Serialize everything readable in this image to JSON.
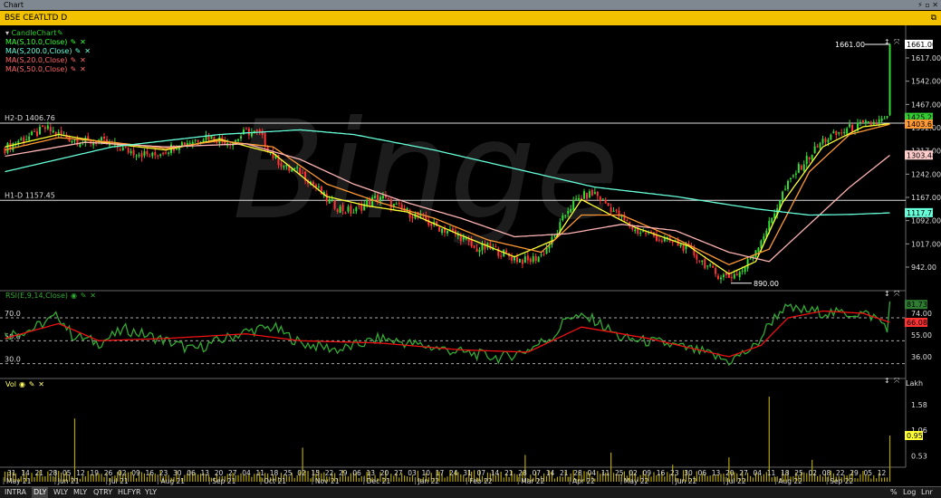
{
  "window": {
    "title": "Chart",
    "controls": [
      "⚡",
      "▫",
      "✕"
    ]
  },
  "symbol_bar": {
    "symbol": "BSE CEATLTD D",
    "icon": "restore-icon"
  },
  "main_panel": {
    "chart_label": "CandleChart",
    "indicators": [
      {
        "label": "MA(S,10.0,Close)",
        "color": "#33ff33"
      },
      {
        "label": "MA(S,200.0,Close)",
        "color": "#66ffd9"
      },
      {
        "label": "MA(S,20.0,Close)",
        "color": "#ff6666"
      },
      {
        "label": "MA(S,50.0,Close)",
        "color": "#ff6666"
      }
    ],
    "hlines": [
      {
        "label": "H2-D 1406.76",
        "value": 1406.76
      },
      {
        "label": "H1-D 1157.45",
        "value": 1157.45
      }
    ],
    "price_axis": [
      "1617.00",
      "1542.00",
      "1467.00",
      "1392.00",
      "1317.00",
      "1242.00",
      "1167.00",
      "1092.00",
      "1017.00",
      "942.00"
    ],
    "price_tags": [
      {
        "text": "1661.00",
        "value": 1661.0,
        "bg": "#ffffff",
        "fg": "#000000"
      },
      {
        "text": "1425.25",
        "value": 1425.25,
        "bg": "#33cc33",
        "fg": "#000000"
      },
      {
        "text": "1403.65",
        "value": 1403.65,
        "bg": "#ff9933",
        "fg": "#000000"
      },
      {
        "text": "1303.48",
        "value": 1303.48,
        "bg": "#ffcccc",
        "fg": "#000000"
      },
      {
        "text": "1117.73",
        "value": 1117.73,
        "bg": "#66ffd9",
        "fg": "#000000"
      }
    ],
    "annotations": [
      {
        "text": "1661.00",
        "value": 1661.0
      },
      {
        "text": "890.00",
        "value": 890.0
      }
    ],
    "watermark": "Binge"
  },
  "rsi_panel": {
    "label": "RSI(E,9,14,Close)",
    "levels": [
      "70.0",
      "50.0",
      "30.0"
    ],
    "axis": [
      "74.00",
      "55.00",
      "36.00"
    ],
    "tags": [
      {
        "text": "81.73",
        "bg": "#2e7d32",
        "fg": "#000000"
      },
      {
        "text": "66.08",
        "bg": "#ff3333",
        "fg": "#000000"
      }
    ]
  },
  "vol_panel": {
    "label": "Vol",
    "unit": "Lakh",
    "axis": [
      "1.58",
      "1.06",
      "0.53"
    ],
    "tag": {
      "text": "0.95",
      "bg": "#ffff33",
      "fg": "#000000"
    }
  },
  "date_axis": {
    "days": [
      "31",
      "14",
      "21",
      "28",
      "05",
      "12",
      "19",
      "26",
      "02",
      "09",
      "16",
      "23",
      "30",
      "06",
      "13",
      "20",
      "27",
      "04",
      "11",
      "18",
      "25",
      "02",
      "15",
      "22",
      "29",
      "06",
      "13",
      "20",
      "27",
      "03",
      "10",
      "17",
      "24",
      "31",
      "07",
      "14",
      "21",
      "28",
      "07",
      "14",
      "21",
      "28",
      "04",
      "11",
      "25",
      "02",
      "09",
      "16",
      "23",
      "30",
      "06",
      "13",
      "20",
      "27",
      "04",
      "11",
      "18",
      "25",
      "02",
      "08",
      "22",
      "29",
      "05",
      "12"
    ],
    "months": [
      "May 21",
      "Jun 21",
      "Jul 21",
      "Aug 21",
      "Sep 21",
      "Oct 21",
      "Nov 21",
      "Dec 21",
      "Jan 22",
      "Feb 22",
      "Mar 22",
      "Apr 22",
      "May 22",
      "Jun 22",
      "Jul 22",
      "Aug 22",
      "Sep 22"
    ]
  },
  "bottom_bar": {
    "timeframes": [
      "INTRA",
      "DLY",
      "WLY",
      "MLY",
      "QTRY",
      "HLFYR",
      "YLY"
    ],
    "active": "DLY",
    "right": [
      "%",
      "Log",
      "Lnr"
    ]
  },
  "chart_data": {
    "type": "candlestick",
    "y_range": [
      890,
      1661
    ],
    "series": [
      {
        "name": "CandleChart",
        "anchors": [
          [
            0,
            1325
          ],
          [
            5,
            1350
          ],
          [
            10,
            1365
          ],
          [
            15,
            1390
          ],
          [
            20,
            1370
          ],
          [
            25,
            1355
          ],
          [
            30,
            1345
          ],
          [
            35,
            1350
          ],
          [
            40,
            1335
          ],
          [
            45,
            1320
          ],
          [
            50,
            1310
          ],
          [
            55,
            1300
          ],
          [
            60,
            1320
          ],
          [
            65,
            1340
          ],
          [
            70,
            1350
          ],
          [
            75,
            1365
          ],
          [
            80,
            1355
          ],
          [
            85,
            1345
          ],
          [
            90,
            1380
          ],
          [
            95,
            1370
          ],
          [
            100,
            1300
          ],
          [
            105,
            1260
          ],
          [
            110,
            1250
          ],
          [
            115,
            1210
          ],
          [
            120,
            1160
          ],
          [
            125,
            1130
          ],
          [
            130,
            1120
          ],
          [
            135,
            1150
          ],
          [
            140,
            1170
          ],
          [
            145,
            1140
          ],
          [
            150,
            1120
          ],
          [
            155,
            1100
          ],
          [
            160,
            1075
          ],
          [
            165,
            1060
          ],
          [
            170,
            1040
          ],
          [
            175,
            1000
          ],
          [
            180,
            1005
          ],
          [
            185,
            990
          ],
          [
            190,
            970
          ],
          [
            195,
            960
          ],
          [
            200,
            980
          ],
          [
            205,
            1040
          ],
          [
            210,
            1130
          ],
          [
            215,
            1170
          ],
          [
            220,
            1180
          ],
          [
            225,
            1140
          ],
          [
            230,
            1100
          ],
          [
            235,
            1060
          ],
          [
            240,
            1050
          ],
          [
            245,
            1030
          ],
          [
            250,
            1020
          ],
          [
            255,
            1000
          ],
          [
            260,
            960
          ],
          [
            265,
            920
          ],
          [
            270,
            910
          ],
          [
            275,
            930
          ],
          [
            280,
            1000
          ],
          [
            285,
            1080
          ],
          [
            290,
            1180
          ],
          [
            295,
            1250
          ],
          [
            300,
            1300
          ],
          [
            305,
            1350
          ],
          [
            310,
            1370
          ],
          [
            315,
            1390
          ],
          [
            320,
            1400
          ],
          [
            325,
            1410
          ],
          [
            329,
            1420
          ],
          [
            330,
            1661
          ]
        ]
      },
      {
        "name": "MA(S,10.0,Close)",
        "anchors": [
          [
            0,
            1330
          ],
          [
            20,
            1370
          ],
          [
            40,
            1340
          ],
          [
            60,
            1320
          ],
          [
            80,
            1355
          ],
          [
            100,
            1310
          ],
          [
            120,
            1170
          ],
          [
            135,
            1140
          ],
          [
            150,
            1120
          ],
          [
            170,
            1045
          ],
          [
            190,
            975
          ],
          [
            205,
            1030
          ],
          [
            215,
            1160
          ],
          [
            235,
            1070
          ],
          [
            255,
            1010
          ],
          [
            270,
            920
          ],
          [
            280,
            960
          ],
          [
            290,
            1150
          ],
          [
            305,
            1330
          ],
          [
            320,
            1395
          ],
          [
            330,
            1405
          ]
        ]
      },
      {
        "name": "MA(S,20.0,Close)",
        "anchors": [
          [
            0,
            1320
          ],
          [
            20,
            1360
          ],
          [
            40,
            1345
          ],
          [
            60,
            1325
          ],
          [
            80,
            1350
          ],
          [
            100,
            1330
          ],
          [
            120,
            1210
          ],
          [
            140,
            1150
          ],
          [
            160,
            1100
          ],
          [
            180,
            1030
          ],
          [
            200,
            990
          ],
          [
            215,
            1110
          ],
          [
            230,
            1110
          ],
          [
            250,
            1035
          ],
          [
            270,
            950
          ],
          [
            285,
            1000
          ],
          [
            300,
            1250
          ],
          [
            315,
            1370
          ],
          [
            330,
            1403
          ]
        ]
      },
      {
        "name": "MA(S,50.0,Close)",
        "anchors": [
          [
            0,
            1300
          ],
          [
            30,
            1345
          ],
          [
            60,
            1330
          ],
          [
            90,
            1340
          ],
          [
            110,
            1290
          ],
          [
            130,
            1210
          ],
          [
            150,
            1150
          ],
          [
            170,
            1100
          ],
          [
            190,
            1040
          ],
          [
            210,
            1050
          ],
          [
            230,
            1080
          ],
          [
            250,
            1060
          ],
          [
            270,
            990
          ],
          [
            285,
            960
          ],
          [
            300,
            1080
          ],
          [
            315,
            1200
          ],
          [
            330,
            1303
          ]
        ]
      },
      {
        "name": "MA(S,200.0,Close)",
        "anchors": [
          [
            0,
            1250
          ],
          [
            40,
            1330
          ],
          [
            80,
            1370
          ],
          [
            110,
            1385
          ],
          [
            130,
            1370
          ],
          [
            160,
            1320
          ],
          [
            190,
            1260
          ],
          [
            220,
            1200
          ],
          [
            250,
            1170
          ],
          [
            280,
            1130
          ],
          [
            300,
            1110
          ],
          [
            315,
            1112
          ],
          [
            330,
            1117
          ]
        ]
      }
    ],
    "rsi": {
      "rsi_anchors": [
        [
          0,
          55
        ],
        [
          10,
          60
        ],
        [
          20,
          72
        ],
        [
          25,
          55
        ],
        [
          35,
          48
        ],
        [
          45,
          60
        ],
        [
          60,
          50
        ],
        [
          70,
          42
        ],
        [
          90,
          58
        ],
        [
          100,
          62
        ],
        [
          110,
          48
        ],
        [
          125,
          42
        ],
        [
          140,
          52
        ],
        [
          150,
          48
        ],
        [
          170,
          40
        ],
        [
          185,
          35
        ],
        [
          195,
          42
        ],
        [
          205,
          55
        ],
        [
          210,
          72
        ],
        [
          220,
          68
        ],
        [
          230,
          52
        ],
        [
          245,
          48
        ],
        [
          260,
          40
        ],
        [
          270,
          32
        ],
        [
          280,
          45
        ],
        [
          285,
          65
        ],
        [
          290,
          78
        ],
        [
          300,
          76
        ],
        [
          310,
          74
        ],
        [
          320,
          74
        ],
        [
          325,
          70
        ],
        [
          329,
          62
        ],
        [
          330,
          81.73
        ]
      ],
      "signal_anchors": [
        [
          0,
          52
        ],
        [
          20,
          65
        ],
        [
          35,
          50
        ],
        [
          60,
          52
        ],
        [
          90,
          56
        ],
        [
          110,
          50
        ],
        [
          140,
          48
        ],
        [
          170,
          42
        ],
        [
          195,
          40
        ],
        [
          215,
          62
        ],
        [
          240,
          52
        ],
        [
          270,
          36
        ],
        [
          282,
          46
        ],
        [
          292,
          70
        ],
        [
          305,
          76
        ],
        [
          320,
          74
        ],
        [
          330,
          66.08
        ]
      ]
    },
    "volume": {
      "unit": "Lakh",
      "max": 1.9,
      "spikes": [
        [
          26,
          1.3
        ],
        [
          111,
          0.7
        ],
        [
          194,
          0.55
        ],
        [
          226,
          0.6
        ],
        [
          249,
          0.35
        ],
        [
          270,
          0.5
        ],
        [
          285,
          1.75
        ],
        [
          301,
          0.45
        ],
        [
          330,
          0.95
        ]
      ]
    }
  }
}
